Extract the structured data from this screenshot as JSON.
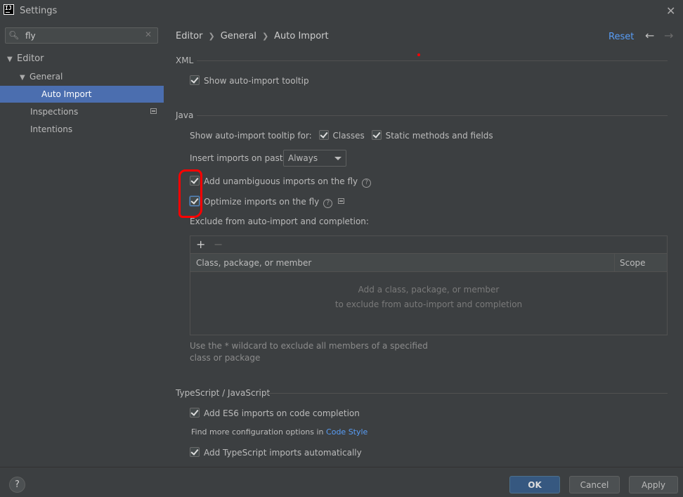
{
  "window": {
    "title": "Settings",
    "app_icon_text": "IJ"
  },
  "search": {
    "value": "fly"
  },
  "tree": {
    "editor": "Editor",
    "general": "General",
    "auto_import": "Auto Import",
    "inspections": "Inspections",
    "intentions": "Intentions"
  },
  "breadcrumb": {
    "part1": "Editor",
    "part2": "General",
    "part3": "Auto Import"
  },
  "header": {
    "reset": "Reset"
  },
  "xml": {
    "title": "XML",
    "show_tooltip": "Show auto-import tooltip"
  },
  "java": {
    "title": "Java",
    "tooltip_for": "Show auto-import tooltip for:",
    "classes": "Classes",
    "static_methods": "Static methods and fields",
    "insert_on_paste": "Insert imports on paste:",
    "paste_value": "Always",
    "add_unambiguous": "Add unambiguous imports on the fly",
    "optimize": "Optimize imports on the fly",
    "exclude_label": "Exclude from auto-import and completion:",
    "table": {
      "col1": "Class, package, or member",
      "col2": "Scope",
      "empty_line1": "Add a class, package, or member",
      "empty_line2": "to exclude from auto-import and completion"
    },
    "hint": "Use the * wildcard to exclude all members of a specified class or package"
  },
  "ts": {
    "title": "TypeScript / JavaScript",
    "es6": "Add ES6 imports on code completion",
    "find_more": "Find more configuration options in",
    "code_style": "Code Style",
    "ts_auto": "Add TypeScript imports automatically"
  },
  "buttons": {
    "help": "?",
    "ok": "OK",
    "cancel": "Cancel",
    "apply": "Apply"
  },
  "colors": {
    "accent": "#4b6eaf",
    "link": "#589df6",
    "annotation": "#ff0000"
  }
}
